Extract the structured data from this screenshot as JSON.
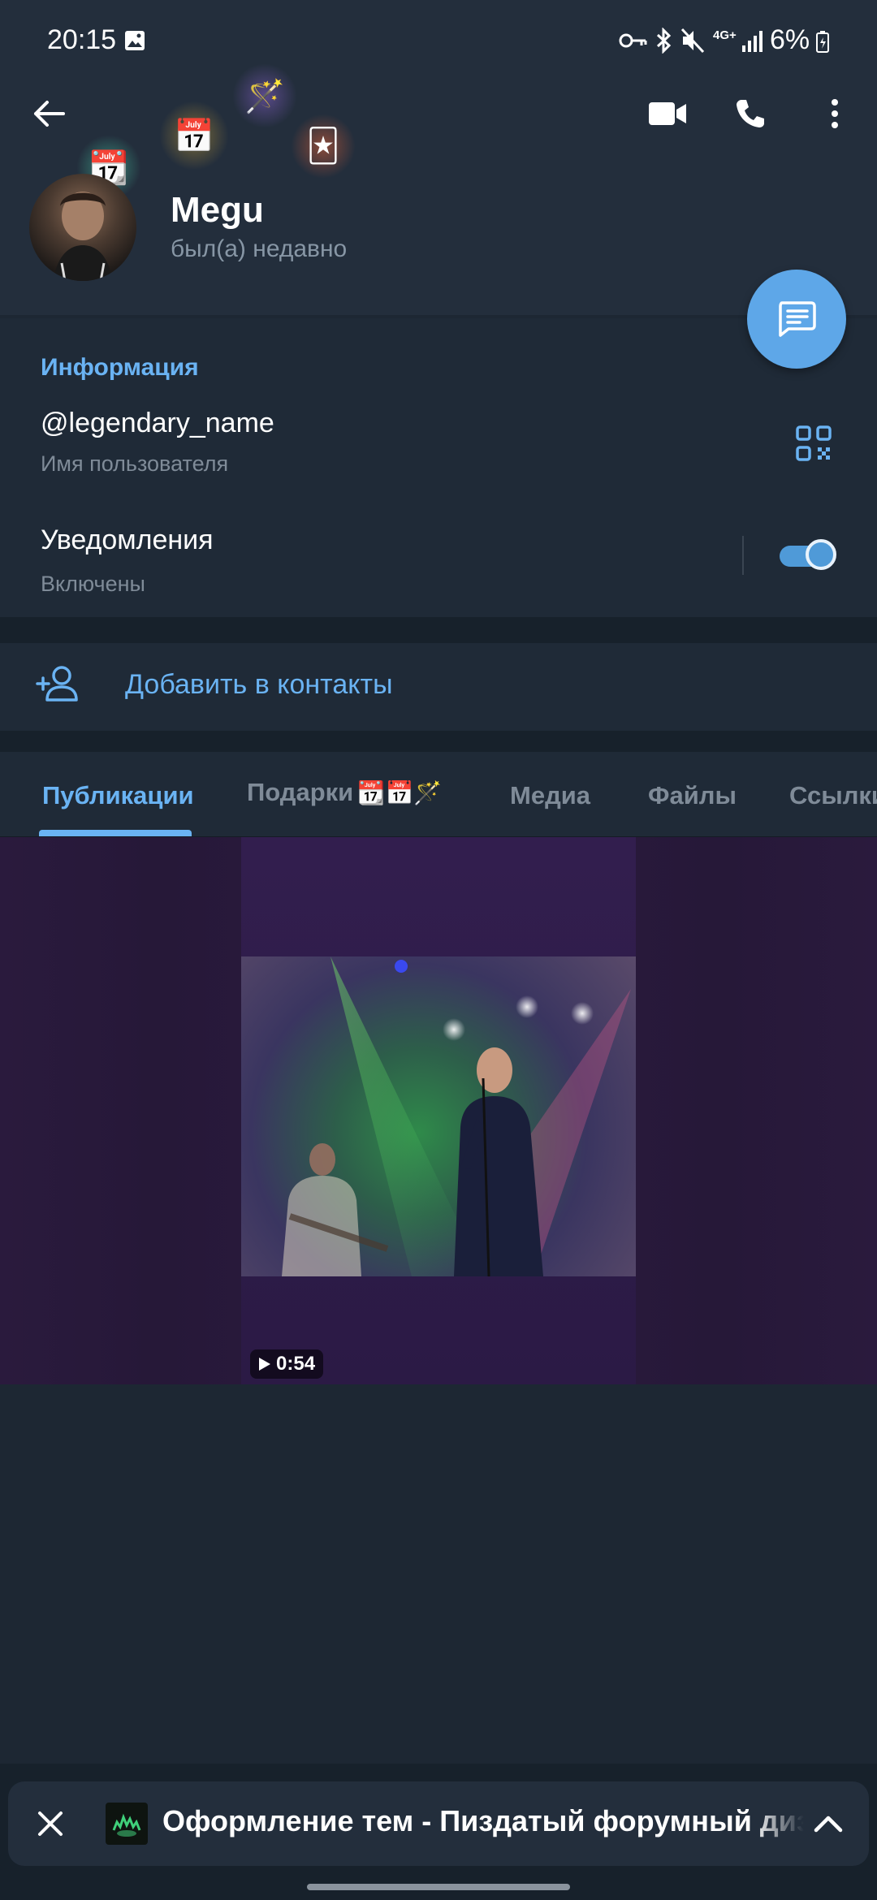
{
  "status_bar": {
    "time": "20:15",
    "battery": "6%",
    "network": "4G+",
    "icons": [
      "image-icon",
      "key-icon",
      "bluetooth-icon",
      "mute-icon",
      "signal-icon",
      "battery-icon"
    ]
  },
  "header": {
    "name": "Megu",
    "status": "был(а) недавно",
    "actions": [
      "back-arrow-icon",
      "video-call-icon",
      "phone-icon",
      "more-vertical-icon"
    ]
  },
  "info": {
    "section_title": "Информация",
    "username": "@legendary_name",
    "username_caption": "Имя пользователя",
    "notifications_label": "Уведомления",
    "notifications_state": "Включены",
    "notifications_on": true
  },
  "add_contact": {
    "label": "Добавить в контакты"
  },
  "tabs": [
    {
      "label": "Публикации",
      "active": true
    },
    {
      "label": "Подарки",
      "active": false
    },
    {
      "label": "Медиа",
      "active": false
    },
    {
      "label": "Файлы",
      "active": false
    },
    {
      "label": "Ссылки",
      "active": false
    }
  ],
  "media": {
    "duration": "0:54"
  },
  "player": {
    "title": "Оформление тем - Пиздатый форумный дизайн"
  },
  "colors": {
    "accent": "#6ab3f3",
    "background": "#1d2733",
    "header": "#232e3c"
  }
}
